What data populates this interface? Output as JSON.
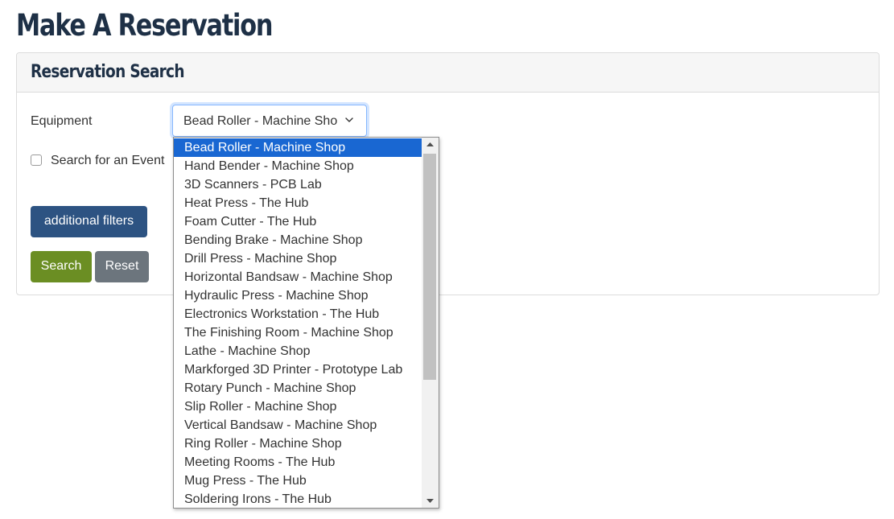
{
  "page": {
    "title": "Make A Reservation"
  },
  "search_card": {
    "title": "Reservation Search",
    "equipment_label": "Equipment",
    "equipment_selected": "Bead Roller - Machine Shop",
    "event_checkbox_label": "Search for an Event",
    "event_checked": false,
    "filters_button": "additional filters",
    "search_button": "Search",
    "reset_button": "Reset"
  },
  "dropdown": {
    "options": [
      "Bead Roller - Machine Shop",
      "Hand Bender - Machine Shop",
      "3D Scanners - PCB Lab",
      "Heat Press - The Hub",
      "Foam Cutter - The Hub",
      "Bending Brake - Machine Shop",
      "Drill Press - Machine Shop",
      "Horizontal Bandsaw - Machine Shop",
      "Hydraulic Press - Machine Shop",
      "Electronics Workstation - The Hub",
      "The Finishing Room - Machine Shop",
      "Lathe - Machine Shop",
      "Markforged 3D Printer - Prototype Lab",
      "Rotary Punch - Machine Shop",
      "Slip Roller - Machine Shop",
      "Vertical Bandsaw - Machine Shop",
      "Ring Roller - Machine Shop",
      "Meeting Rooms - The Hub",
      "Mug Press - The Hub",
      "Soldering Irons - The Hub"
    ],
    "selected_index": 0
  },
  "icons": {
    "select_chevron": "chevron-down-icon",
    "scroll_up": "triangle-up-icon",
    "scroll_down": "triangle-down-icon"
  },
  "colors": {
    "title": "#1e3046",
    "filters_button": "#2d5382",
    "search_button": "#6b8e23",
    "reset_button": "#6c757d",
    "selected_option": "#1967d2"
  }
}
